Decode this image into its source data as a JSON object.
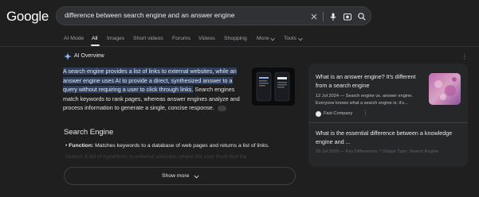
{
  "header": {
    "logo": "Google",
    "search_query": "difference between search engine and an answer engine"
  },
  "tabs": [
    {
      "label": "AI Mode"
    },
    {
      "label": "All"
    },
    {
      "label": "Images"
    },
    {
      "label": "Short videos"
    },
    {
      "label": "Forums"
    },
    {
      "label": "Videos"
    },
    {
      "label": "Shopping"
    },
    {
      "label": "More"
    },
    {
      "label": "Tools"
    }
  ],
  "ai_overview": {
    "title": "AI Overview",
    "highlighted_text": "A search engine provides a list of links to external websites, while an answer engine uses AI to provide a direct, synthesized answer to a query without requiring a user to click through links.",
    "body_text": " Search engines match keywords to rank pages, whereas answer engines analyze and process information to generate a single, concise response.",
    "section_heading": "Search Engine",
    "bullet_label": "Function:",
    "bullet_text": " Matches keywords to a database of web pages and returns a list of links.",
    "faded_text": "Output: A list of hyperlinks to external websites where the user must find the",
    "show_more": "Show more"
  },
  "sources": [
    {
      "title": "What is an answer engine? It's different from a search engine",
      "snippet": "12 Jul 2024 — Search engine vs. answer engine. Everyone knows what a search engine is: it's...",
      "site": "Fast Company"
    },
    {
      "title": "What is the essential difference between a knowledge engine and ...",
      "snippet": "29 Jul 2025 — Key Differences: * Output Type: Search Engine"
    }
  ],
  "colors": {
    "background": "#1f1f1f",
    "highlight": "#2d3e5f",
    "panel": "#262729"
  }
}
